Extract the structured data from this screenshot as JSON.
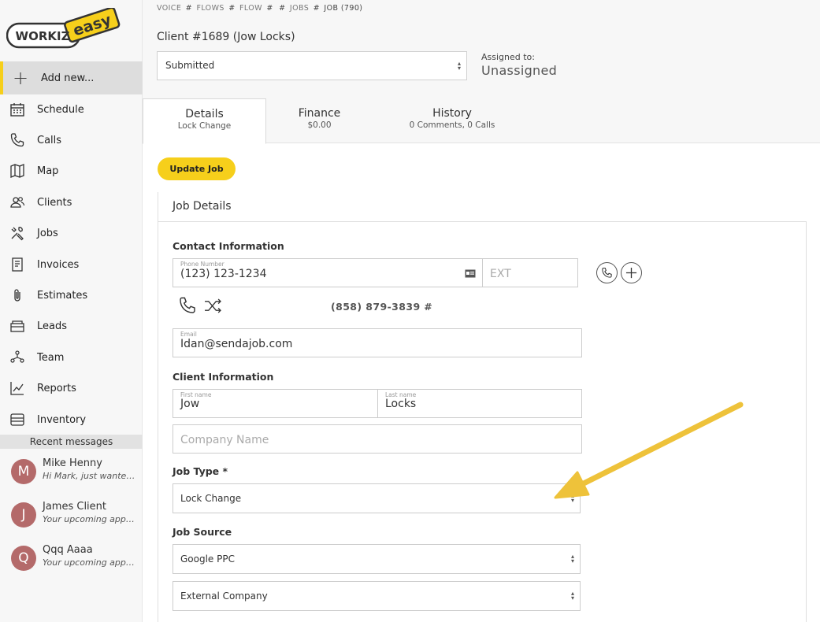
{
  "logo": {
    "word1": "WORKIZ",
    "word2": "easy"
  },
  "sidebar": {
    "add_new": "Add new...",
    "items": [
      {
        "label": "Schedule",
        "icon": "calendar-icon"
      },
      {
        "label": "Calls",
        "icon": "phone-icon"
      },
      {
        "label": "Map",
        "icon": "map-icon"
      },
      {
        "label": "Clients",
        "icon": "clients-icon"
      },
      {
        "label": "Jobs",
        "icon": "tools-icon"
      },
      {
        "label": "Invoices",
        "icon": "invoice-icon"
      },
      {
        "label": "Estimates",
        "icon": "paperclip-icon"
      },
      {
        "label": "Leads",
        "icon": "leads-icon"
      },
      {
        "label": "Team",
        "icon": "team-icon"
      },
      {
        "label": "Reports",
        "icon": "chart-icon"
      },
      {
        "label": "Inventory",
        "icon": "inventory-icon"
      }
    ],
    "recent_title": "Recent messages",
    "messages": [
      {
        "initial": "M",
        "name": "Mike Henny",
        "preview": "Hi Mark, just wanted to"
      },
      {
        "initial": "J",
        "name": "James Client",
        "preview": "Your upcoming appointment"
      },
      {
        "initial": "Q",
        "name": "Qqq Aaaa",
        "preview": "Your upcoming appointment"
      }
    ]
  },
  "breadcrumb": {
    "voice": "VOICE",
    "flows": "FLOWS",
    "flow": "FLOW",
    "jobs": "JOBS",
    "current": "JOB (790)",
    "sep": "#"
  },
  "client_title": "Client #1689 (Jow Locks)",
  "status_select": {
    "value": "Submitted"
  },
  "assigned": {
    "label": "Assigned to:",
    "value": "Unassigned"
  },
  "tabs": [
    {
      "title": "Details",
      "sub": "Lock Change"
    },
    {
      "title": "Finance",
      "sub": "$0.00"
    },
    {
      "title": "History",
      "sub": "0 Comments, 0 Calls"
    }
  ],
  "update_button": "Update Job",
  "job_details_title": "Job Details",
  "contact": {
    "title": "Contact Information",
    "phone_label": "Phone Number",
    "phone_value": "(123) 123-1234",
    "ext_placeholder": "EXT",
    "tracking_number": "(858) 879-3839 #",
    "email_label": "Email",
    "email_value": "Idan@sendajob.com"
  },
  "client_info": {
    "title": "Client Information",
    "first_label": "First name",
    "first_value": "Jow",
    "last_label": "Last name",
    "last_value": "Locks",
    "company_placeholder": "Company Name"
  },
  "job_type": {
    "title": "Job Type *",
    "value": "Lock Change"
  },
  "job_source": {
    "title": "Job Source",
    "value": "Google PPC",
    "value2": "External Company"
  },
  "colors": {
    "accent": "#f6cf1b",
    "avatar": "#b46a6a",
    "arrow": "#eec23a"
  }
}
